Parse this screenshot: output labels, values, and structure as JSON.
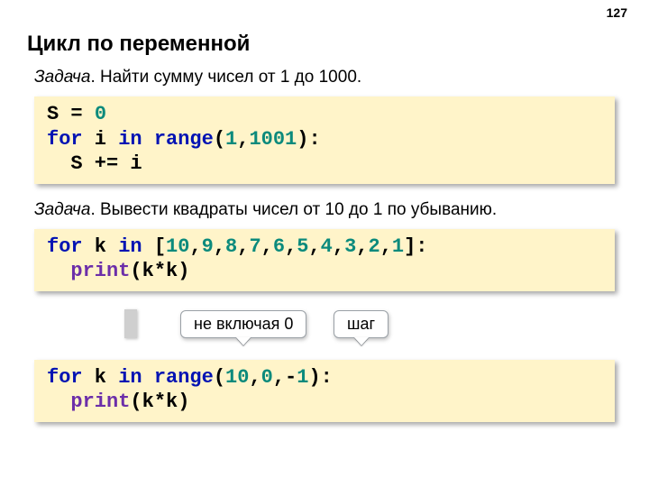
{
  "page_number": "127",
  "title": "Цикл по переменной",
  "task1_label": "Задача",
  "task1_text": ". Найти сумму чисел от 1 до 1000.",
  "task2_label": "Задача",
  "task2_text": ". Вывести квадраты чисел от 10 до 1 по убыванию.",
  "annot1": "не включая 0",
  "annot2": "шаг",
  "code1": {
    "t1": "S = ",
    "t2": "0",
    "t3": "for",
    "t4": " i ",
    "t5": "in",
    "t6": " ",
    "t7": "range",
    "t8": "(",
    "t9": "1",
    "t10": ",",
    "t11": "1001",
    "t12": "):",
    "t13": "  S += i"
  },
  "code2": {
    "t1": "for",
    "t2": " k ",
    "t3": "in",
    "t4": " [",
    "t5": "10",
    "c": ",",
    "n9": "9",
    "n8": "8",
    "n7": "7",
    "n6": "6",
    "n5": "5",
    "n4": "4",
    "n3": "3",
    "n2": "2",
    "n1": "1",
    "t6": "]:",
    "t7": "  ",
    "t8": "print",
    "t9": "(k*k)"
  },
  "code3": {
    "t1": "for",
    "t2": " k ",
    "t3": "in",
    "t4": " ",
    "t5": "range",
    "t6": "(",
    "t7": "10",
    "t8": ",",
    "t9": "0",
    "t10": ",-",
    "t11": "1",
    "t12": "):",
    "t13": "  ",
    "t14": "print",
    "t15": "(k*k)"
  }
}
